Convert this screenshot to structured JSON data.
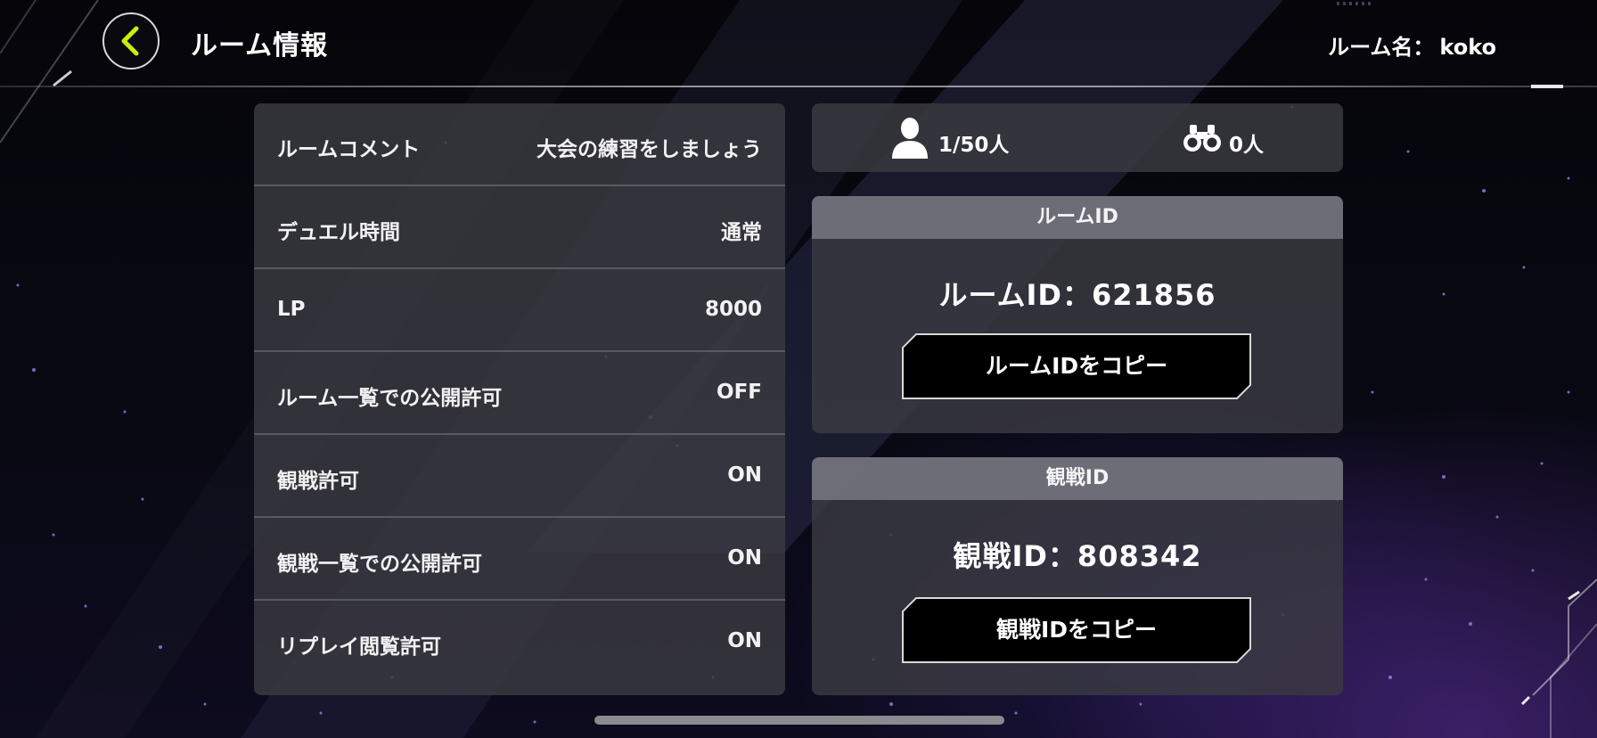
{
  "header": {
    "title": "ルーム情報",
    "room_name_label": "ルーム名：",
    "room_name_value": "koko"
  },
  "settings": [
    {
      "label": "ルームコメント",
      "value": "大会の練習をしましょう"
    },
    {
      "label": "デュエル時間",
      "value": "通常"
    },
    {
      "label": "LP",
      "value": "8000"
    },
    {
      "label": "ルーム一覧での公開許可",
      "value": "OFF"
    },
    {
      "label": "観戦許可",
      "value": "ON"
    },
    {
      "label": "観戦一覧での公開許可",
      "value": "ON"
    },
    {
      "label": "リプレイ閲覧許可",
      "value": "ON"
    }
  ],
  "counts": {
    "players": "1/50人",
    "spectators": "0人"
  },
  "room_id_card": {
    "header": "ルームID",
    "value": "ルームID：621856",
    "copy_label": "ルームIDをコピー"
  },
  "spectate_id_card": {
    "header": "観戦ID",
    "value": "観戦ID：808342",
    "copy_label": "観戦IDをコピー"
  },
  "icons": {
    "back": "chevron-left-icon",
    "player": "person-icon",
    "spectator": "binoculars-icon"
  },
  "colors": {
    "accent": "#c8f000",
    "panel": "#3a3a42",
    "card_header": "#78787f"
  }
}
